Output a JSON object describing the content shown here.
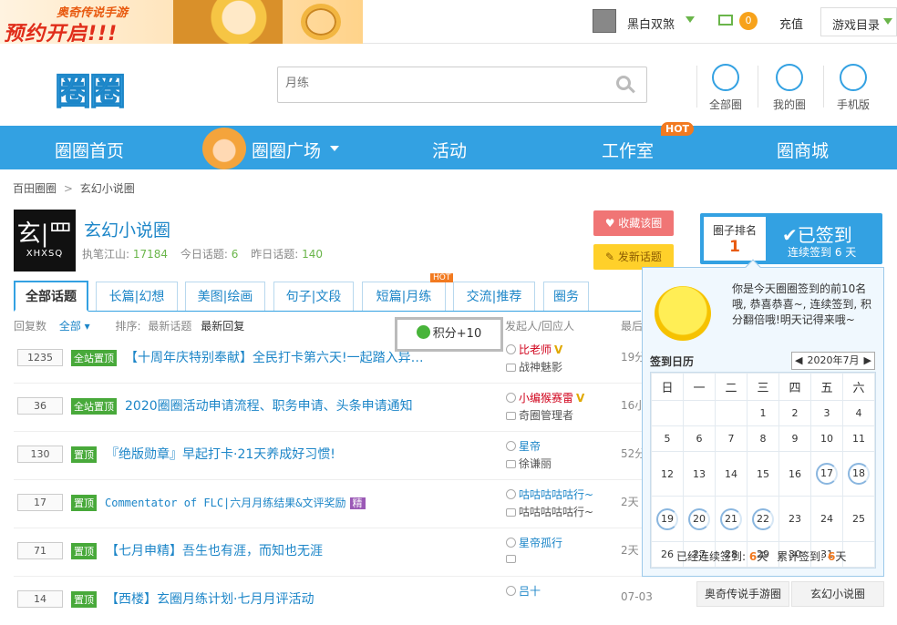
{
  "top_bar": {
    "promo_line1": "奥奇传说手游",
    "promo_line2": "预约开启!!!",
    "user_name": "黑白双煞",
    "mail_count": "0",
    "recharge": "充值",
    "game_menu": "游戏目录"
  },
  "header": {
    "logo": "圈圈",
    "search_placeholder": "月练",
    "icons": [
      {
        "icon": "circle-icon",
        "label": "全部圈"
      },
      {
        "icon": "user-icon",
        "label": "我的圈"
      },
      {
        "icon": "wifi-icon",
        "label": "手机版"
      }
    ]
  },
  "nav": {
    "items": [
      "圈圈首页",
      "圈圈广场",
      "活动",
      "工作室",
      "圈商城"
    ],
    "hot": "HOT"
  },
  "breadcrumb": {
    "root": "百田圈圈",
    "sep": ">",
    "current": "玄幻小说圈"
  },
  "circle": {
    "logo_main": "玄|罒",
    "logo_sub": "XHXSQ",
    "title": "玄幻小说圈",
    "leader_label": "执笔江山:",
    "leader_value": "17184",
    "today_label": "今日话题:",
    "today_value": "6",
    "yesterday_label": "昨日话题:",
    "yesterday_value": "140",
    "fav_button": "收藏该圈",
    "post_button": "发新话题"
  },
  "tabs": [
    "全部话题",
    "长篇|幻想",
    "美图|绘画",
    "句子|文段",
    "短篇|月练",
    "交流|推荐",
    "圈务"
  ],
  "tab_hot": "HOT",
  "list_header": {
    "replies": "回复数",
    "all": "全部",
    "sort": "排序:",
    "latest_topic": "最新话题",
    "latest_reply": "最新回复",
    "author": "发起人/回应人",
    "last": "最后"
  },
  "rows": [
    {
      "count": "1235",
      "tag": "全站置顶",
      "title": "【十周年庆特别奉献】全民打卡第六天!一起踏入异…",
      "author": "比老师",
      "vip": "V",
      "replier": "战神魅影",
      "time": "19分"
    },
    {
      "count": "36",
      "tag": "全站置顶",
      "title": "2020圈圈活动申请流程、职务申请、头条申请通知",
      "author": "小编猴赛雷",
      "vip": "V",
      "replier": "奇圈管理者",
      "time": "16小"
    },
    {
      "count": "130",
      "tag": "置顶",
      "title": "『绝版勋章』早起打卡·21天养成好习惯!",
      "author": "星帝",
      "vip": "",
      "replier": "徐谦丽",
      "time": "52分"
    },
    {
      "count": "17",
      "tag": "置顶",
      "title": "Commentator of FLC|六月月练结果&文评奖励",
      "jing": "精",
      "author": "咕咕咕咕咕行~",
      "vip": "",
      "replier": "咕咕咕咕咕行~",
      "time": "2天"
    },
    {
      "count": "71",
      "tag": "置顶",
      "title": "【七月申精】吾生也有涯，而知也无涯",
      "author": "星帝孤行",
      "vip": "",
      "replier": "",
      "time": "2天"
    },
    {
      "count": "14",
      "tag": "置顶",
      "title": "【西楼】玄圈月练计划·七月月评活动",
      "author": "吕十",
      "vip": "",
      "replier": "",
      "time": "07-03"
    }
  ],
  "score_popup": "积分+10",
  "signin": {
    "rank_label": "圈子排名",
    "rank_value": "1",
    "signed": "已签到",
    "streak": "连续签到 6 天",
    "message": "你是今天圈圈签到的前10名哦, 恭喜恭喜~, 连续签到, 积分翻倍哦!明天记得来哦~",
    "calendar_title": "签到日历",
    "month": "2020年7月",
    "weekdays": [
      "日",
      "一",
      "二",
      "三",
      "四",
      "五",
      "六"
    ],
    "weeks": [
      [
        "",
        "",
        "",
        "1",
        "2",
        "3",
        "4"
      ],
      [
        "5",
        "6",
        "7",
        "8",
        "9",
        "10",
        "11"
      ],
      [
        "12",
        "13",
        "14",
        "15",
        "16",
        "17",
        "18"
      ],
      [
        "19",
        "20",
        "21",
        "22",
        "23",
        "24",
        "25"
      ],
      [
        "26",
        "27",
        "28",
        "29",
        "30",
        "31",
        ""
      ]
    ],
    "signed_days": [
      "17",
      "18",
      "19",
      "20",
      "21",
      "22"
    ],
    "foot_streak_label": "已经连续签到:",
    "foot_streak": "6",
    "foot_total_label": "累计签到:",
    "foot_total": "6",
    "day_unit": "天"
  },
  "side_links": [
    "奥奇传说手游圈",
    "玄幻小说圈"
  ]
}
